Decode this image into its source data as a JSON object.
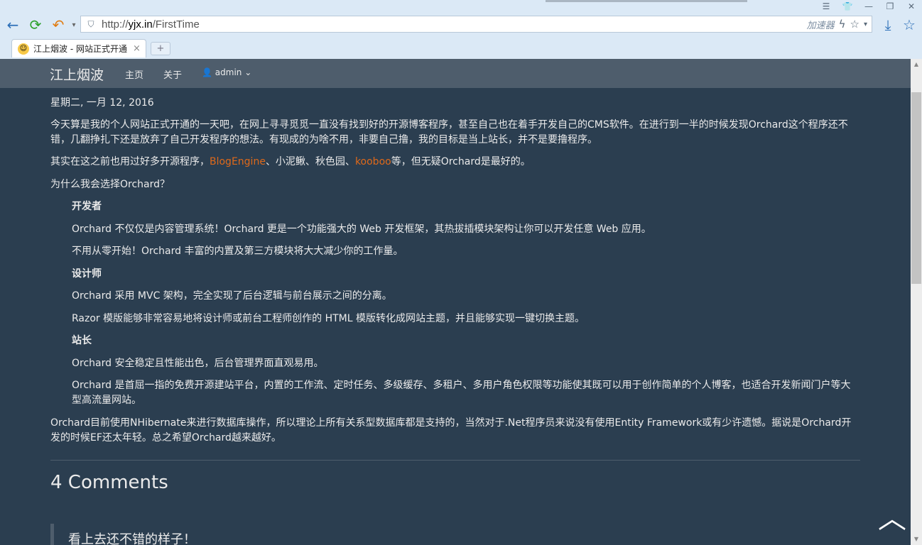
{
  "browser": {
    "url_prefix": "http://",
    "url_host": "yjx.in",
    "url_path": "/FirstTime",
    "accelerator_label": "加速器",
    "tab_title": "江上烟波 - 网站正式开通",
    "newtab_label": "+",
    "close_label": "×"
  },
  "site": {
    "brand": "江上烟波",
    "nav": [
      "主页",
      "关于"
    ],
    "user": "admin"
  },
  "post": {
    "date": "星期二, 一月 12, 2016",
    "p1": "今天算是我的个人网站正式开通的一天吧，在网上寻寻觅觅一直没有找到好的开源博客程序，甚至自己也在着手开发自己的CMS软件。在进行到一半的时候发现Orchard这个程序还不错，几翻挣扎下还是放弃了自己开发程序的想法。有现成的为啥不用，非要自己撸，我的目标是当上站长，并不是要撸程序。",
    "p2_a": "其实在这之前也用过好多开源程序，",
    "link1": "BlogEngine",
    "p2_b": "、小泥鳅、秋色园、",
    "link2": "kooboo",
    "p2_c": "等，但无疑Orchard是最好的。",
    "p3": "为什么我会选择Orchard？",
    "h_dev": "开发者",
    "dev1": "Orchard 不仅仅是内容管理系统！Orchard 更是一个功能强大的 Web 开发框架，其热拔插模块架构让你可以开发任意 Web 应用。",
    "dev2": "不用从零开始！Orchard 丰富的内置及第三方模块将大大减少你的工作量。",
    "h_design": "设计师",
    "des1": "Orchard 采用 MVC 架构，完全实现了后台逻辑与前台展示之间的分离。",
    "des2": "Razor 模版能够非常容易地将设计师或前台工程师创作的 HTML 模版转化成网站主题，并且能够实现一键切换主题。",
    "h_admin": "站长",
    "adm1": "Orchard 安全稳定且性能出色，后台管理界面直观易用。",
    "adm2": "Orchard 是首屈一指的免费开源建站平台，内置的工作流、定时任务、多级缓存、多租户、多用户角色权限等功能使其既可以用于创作简单的个人博客，也适合开发新闻门户等大型高流量网站。",
    "p4": "Orchard目前使用NHibernate来进行数据库操作，所以理论上所有关系型数据库都是支持的，当然对于.Net程序员来说没有使用Entity Framework或有少许遗憾。据说是Orchard开发的时候EF还太年轻。总之希望Orchard越来越好。"
  },
  "comments": {
    "heading": "4 Comments",
    "first": "看上去还不错的样子！"
  }
}
